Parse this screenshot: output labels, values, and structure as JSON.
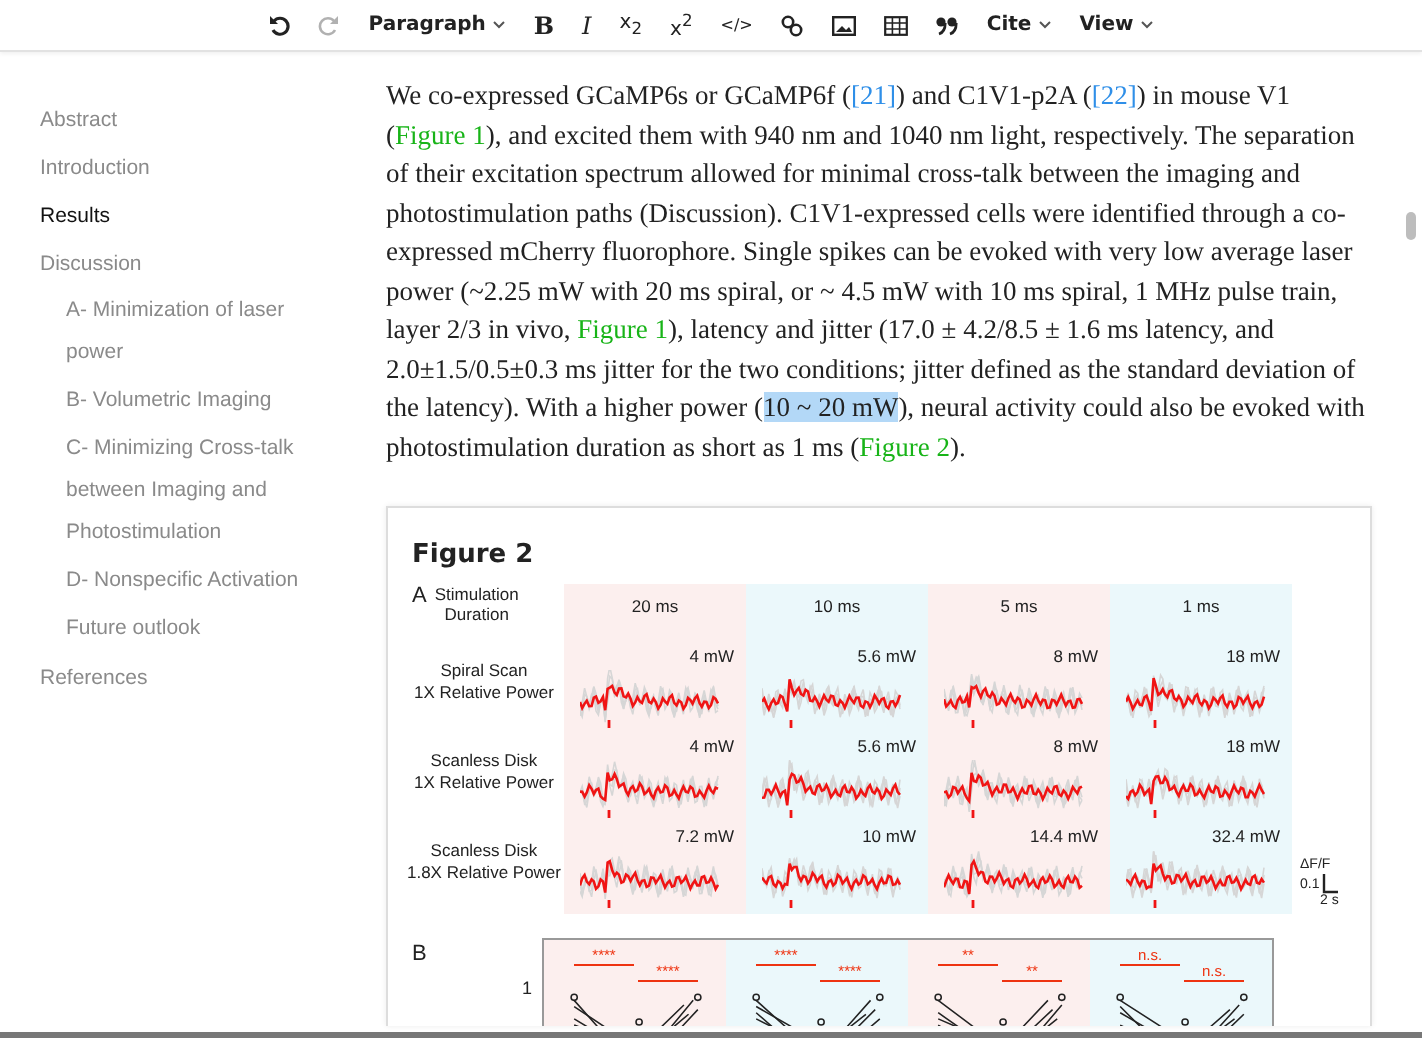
{
  "toolbar": {
    "items": [
      {
        "kind": "undo",
        "disabled": false
      },
      {
        "kind": "redo",
        "disabled": true
      },
      {
        "kind": "dropdown",
        "label": "Paragraph"
      },
      {
        "kind": "bold",
        "label": "B"
      },
      {
        "kind": "italic",
        "label": "I"
      },
      {
        "kind": "script",
        "label": "x$_{2}$"
      },
      {
        "kind": "script",
        "label": "x$^{2}$"
      },
      {
        "kind": "code",
        "label": "</>"
      },
      {
        "kind": "link",
        "disabled": false
      },
      {
        "kind": "image",
        "disabled": false
      },
      {
        "kind": "table",
        "disabled": false
      },
      {
        "kind": "quote",
        "disabled": false
      },
      {
        "kind": "dropdown",
        "label": "Cite"
      },
      {
        "kind": "dropdown",
        "label": "View"
      }
    ]
  },
  "sidebar": {
    "items": [
      {
        "label": "Abstract",
        "selected": false
      },
      {
        "label": "Introduction",
        "selected": false
      },
      {
        "label": "Results",
        "selected": true
      },
      {
        "label": "Discussion",
        "selected": false,
        "children": [
          {
            "label": "A- Minimization of laser power",
            "selected": false
          },
          {
            "label": "B- Volumetric Imaging",
            "selected": false
          },
          {
            "label": "C- Minimizing Cross-talk between Imaging and Photostimulation",
            "selected": false
          },
          {
            "label": "D- Nonspecific Activation",
            "selected": false
          },
          {
            "label": "Future outlook",
            "selected": false
          }
        ]
      },
      {
        "label": "References",
        "selected": false
      }
    ]
  },
  "paragraph": [
    {
      "kind": "text",
      "text": "We co-expressed GCaMP6s or GCaMP6f ("
    },
    {
      "kind": "cite",
      "text": "[21]"
    },
    {
      "kind": "text",
      "text": ") and C1V1-p2A ("
    },
    {
      "kind": "cite",
      "text": "[22]"
    },
    {
      "kind": "text",
      "text": ") in mouse V1 ("
    },
    {
      "kind": "figure",
      "text": "Figure 1"
    },
    {
      "kind": "text",
      "text": "), and excited them with 940 nm and 1040 nm light, respectively. The separation of their excitation spectrum allowed for minimal cross-talk between the imaging and photostimulation paths (Discussion). C1V1-expressed cells were identified through a co-expressed mCherry fluorophore. Single spikes can be evoked with very low average laser power (~2.25 mW with 20 ms spiral, or ~ 4.5 mW with 10 ms spiral, 1 MHz pulse train, layer 2/3 in vivo, "
    },
    {
      "kind": "figure",
      "text": "Figure 1"
    },
    {
      "kind": "text",
      "text": "), latency and jitter (17.0 ± 4.2/8.5 ± 1.6 ms latency, and 2.0±1.5/0.5±0.3 ms jitter for the two conditions; jitter defined as the standard deviation of the latency). With a higher power ("
    },
    {
      "kind": "selection",
      "text": "10 ~ 20 mW"
    },
    {
      "kind": "text",
      "text": "), neural activity could also be evoked with photostimulation duration as short as 1 ms ("
    },
    {
      "kind": "figure",
      "text": "Figure 2"
    },
    {
      "kind": "text",
      "text": ")."
    }
  ],
  "figure": {
    "title": "Figure 2",
    "panel_a": {
      "label": "A",
      "header_lines": [
        "Stimulation",
        "Duration"
      ],
      "columns": [
        {
          "duration": "20 ms",
          "color": "#fcefee"
        },
        {
          "duration": "10 ms",
          "color": "#ebf8fb"
        },
        {
          "duration": "5 ms",
          "color": "#fcefee"
        },
        {
          "duration": "1 ms",
          "color": "#ebf8fb"
        }
      ],
      "rows": [
        {
          "label_lines": [
            "Spiral Scan",
            "1X Relative Power"
          ],
          "powers": [
            "4 mW",
            "5.6 mW",
            "8 mW",
            "18 mW"
          ]
        },
        {
          "label_lines": [
            "Scanless Disk",
            "1X Relative Power"
          ],
          "powers": [
            "4 mW",
            "5.6 mW",
            "8 mW",
            "18 mW"
          ]
        },
        {
          "label_lines": [
            "Scanless Disk",
            "1.8X Relative Power"
          ],
          "powers": [
            "7.2 mW",
            "10 mW",
            "14.4 mW",
            "32.4 mW"
          ]
        }
      ],
      "scale": {
        "y_label": "ΔF/F",
        "y_value": "0.1",
        "x_value": "2 s"
      }
    },
    "panel_b": {
      "label": "B",
      "ytick": "1",
      "columns": [
        {
          "color": "#fcefee",
          "marks": [
            "****",
            "****"
          ]
        },
        {
          "color": "#ebf8fb",
          "marks": [
            "****",
            "****"
          ]
        },
        {
          "color": "#fcefee",
          "marks": [
            "**",
            "**"
          ]
        },
        {
          "color": "#ebf8fb",
          "marks": [
            "n.s.",
            "n.s."
          ]
        }
      ]
    }
  }
}
